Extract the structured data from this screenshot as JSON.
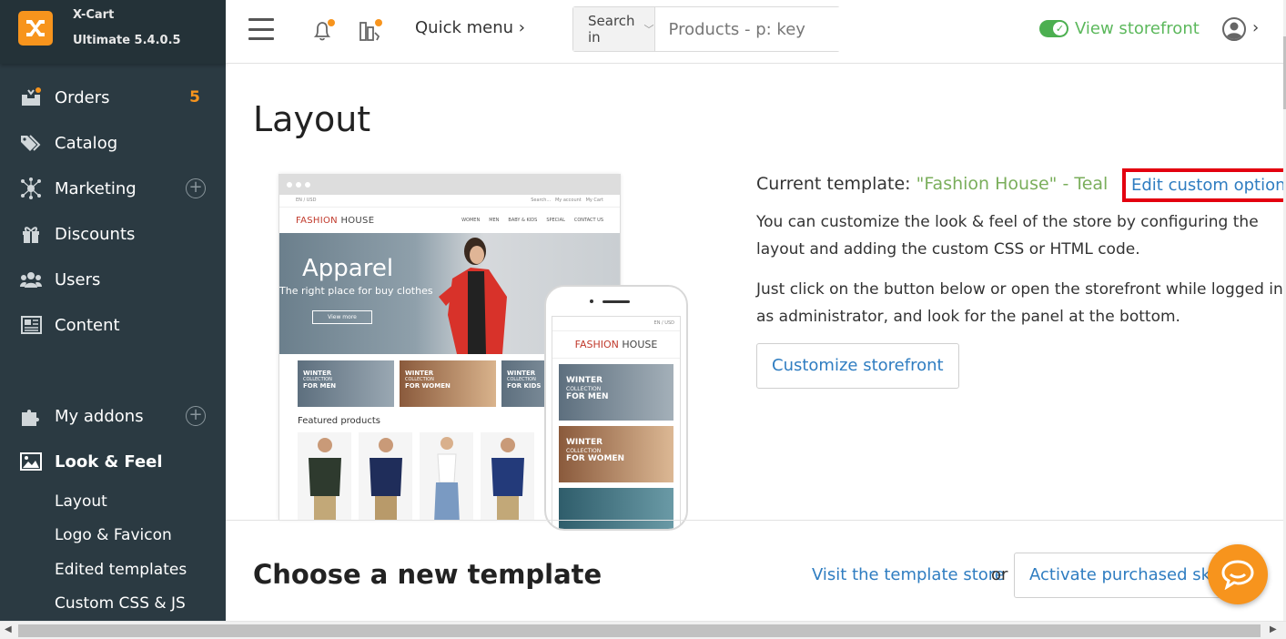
{
  "brand": {
    "name": "X-Cart",
    "edition": "Ultimate 5.4.0.5"
  },
  "sidebar": {
    "items": [
      {
        "label": "Orders",
        "badge": "5"
      },
      {
        "label": "Catalog"
      },
      {
        "label": "Marketing"
      },
      {
        "label": "Discounts"
      },
      {
        "label": "Users"
      },
      {
        "label": "Content"
      },
      {
        "label": "My addons"
      },
      {
        "label": "Look & Feel"
      }
    ],
    "subitems": [
      "Layout",
      "Logo & Favicon",
      "Edited templates",
      "Custom CSS & JS"
    ]
  },
  "header": {
    "quick_menu": "Quick menu ›",
    "search_in": "Search in",
    "search_placeholder": "Products - p: key",
    "view_storefront": "View storefront"
  },
  "main": {
    "title": "Layout",
    "current_label": "Current template:",
    "current_template": "\"Fashion House\" - Teal",
    "edit_link": "Edit custom options",
    "desc1": "You can customize the look & feel of the store by configuring the layout and adding the custom CSS or HTML code.",
    "desc2": "Just click on the button below or open the storefront while logged in as administrator, and look for the panel at the bottom.",
    "customize_button": "Customize storefront",
    "choose_title": "Choose a new template",
    "visit_link": "Visit the template store",
    "or": "or",
    "activate_button": "Activate purchased skin"
  },
  "preview": {
    "logo": "FASHION",
    "logo2": "HOUSE",
    "nav": [
      "WOMEN",
      "MEN",
      "BABY & KIDS",
      "SPECIAL",
      "CONTACT US"
    ],
    "top_left": "EN / USD",
    "top_search": "Search...",
    "top_account": "My account",
    "top_cart": "My Cart",
    "hero_title": "Apparel",
    "hero_sub": "The right place for buy clothes",
    "hero_button": "View more",
    "tile1": [
      "WINTER",
      "COLLECTION",
      "FOR MEN"
    ],
    "tile2": [
      "WINTER",
      "COLLECTION",
      "FOR WOMEN"
    ],
    "tile3": [
      "WINTER",
      "COLLECTION",
      "FOR KIDS"
    ],
    "featured": "Featured products",
    "phone_top": "EN / USD",
    "phone_tile1": [
      "WINTER",
      "COLLECTION",
      "FOR MEN"
    ],
    "phone_tile2": [
      "WINTER",
      "COLLECTION",
      "FOR WOMEN"
    ]
  },
  "colors": {
    "accent": "#f7941d",
    "sidebar": "#2b3a42",
    "link": "#2f7dc1",
    "template": "#7aae5b",
    "highlight": "#e3000f"
  }
}
